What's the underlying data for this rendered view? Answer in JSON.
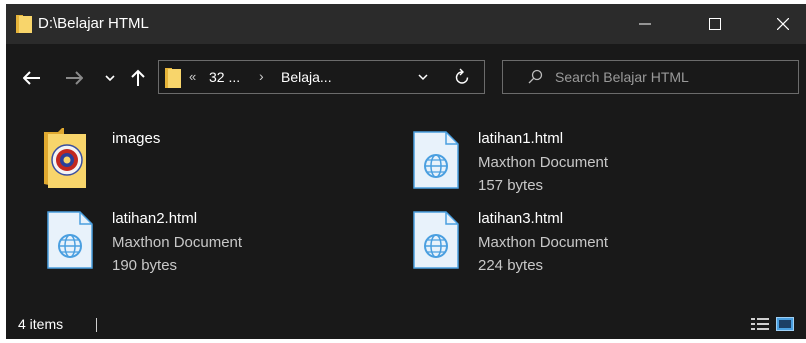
{
  "window": {
    "title": "D:\\Belajar HTML"
  },
  "nav": {
    "breadcrumb_overflow": "«",
    "segment_1": "32 ...",
    "separator": "›",
    "segment_2": "Belaja..."
  },
  "search": {
    "placeholder": "Search Belajar HTML",
    "value": ""
  },
  "items": [
    {
      "name": "images",
      "type": "",
      "size": "",
      "kind": "folder-icon"
    },
    {
      "name": "latihan1.html",
      "type": "Maxthon Document",
      "size": "157 bytes",
      "kind": "html-document-icon"
    },
    {
      "name": "latihan2.html",
      "type": "Maxthon Document",
      "size": "190 bytes",
      "kind": "html-document-icon"
    },
    {
      "name": "latihan3.html",
      "type": "Maxthon Document",
      "size": "224 bytes",
      "kind": "html-document-icon"
    }
  ],
  "status": {
    "item_count": "4 items"
  },
  "colors": {
    "window_bg": "#191919",
    "titlebar_bg": "#2b2b2b",
    "folder_yellow": "#f8d56b",
    "doc_blue": "#4a9fe0"
  }
}
